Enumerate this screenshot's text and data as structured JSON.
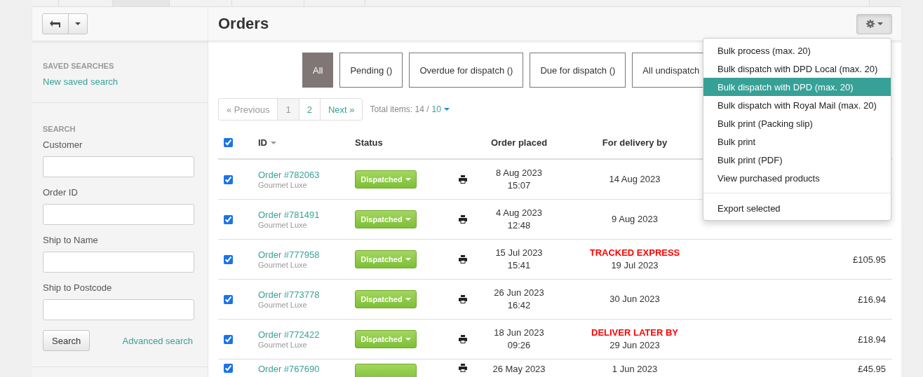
{
  "nav_tabs": [
    {
      "selected": false
    },
    {
      "selected": false
    },
    {
      "selected": true
    },
    {
      "selected": false
    },
    {
      "selected": false
    },
    {
      "selected": false
    },
    {
      "selected": false
    }
  ],
  "header": {
    "title": "Orders"
  },
  "sidebar": {
    "saved_searches": {
      "heading": "SAVED SEARCHES",
      "link": "New saved search"
    },
    "search": {
      "heading": "SEARCH",
      "fields": [
        {
          "label": "Customer"
        },
        {
          "label": "Order ID"
        },
        {
          "label": "Ship to Name"
        },
        {
          "label": "Ship to Postcode"
        }
      ],
      "button": "Search",
      "advanced_link": "Advanced search"
    }
  },
  "filters": [
    {
      "label": "All",
      "selected": true
    },
    {
      "label": "Pending ()",
      "selected": false
    },
    {
      "label": "Overdue for dispatch ()",
      "selected": false
    },
    {
      "label": "Due for dispatch ()",
      "selected": false
    },
    {
      "label": "All undispatch",
      "selected": false
    }
  ],
  "pagination": {
    "previous": {
      "label": "« Previous",
      "disabled": true
    },
    "pages": [
      {
        "label": "1",
        "selected": true
      },
      {
        "label": "2",
        "selected": false
      }
    ],
    "next": {
      "label": "Next »",
      "disabled": false
    },
    "total_label": "Total items:",
    "total": "14",
    "separator": "/",
    "per_page": "10"
  },
  "table": {
    "select_all_checked": true,
    "columns": [
      "ID",
      "Status",
      "Order placed",
      "For delivery by"
    ],
    "rows": [
      {
        "checked": true,
        "id": "Order #782063",
        "customer": "Gourmet Luxe",
        "status": "Dispatched",
        "placed_date": "8 Aug 2023",
        "placed_time": "15:07",
        "delivery": "14 Aug 2023"
      },
      {
        "checked": true,
        "id": "Order #781491",
        "customer": "Gourmet Luxe",
        "status": "Dispatched",
        "placed_date": "4 Aug 2023",
        "placed_time": "12:48",
        "delivery": "9 Aug 2023"
      },
      {
        "checked": true,
        "id": "Order #777958",
        "customer": "Gourmet Luxe",
        "status": "Dispatched",
        "placed_date": "15 Jul 2023",
        "placed_time": "15:41",
        "service": "TRACKED EXPRESS",
        "delivery": "19 Jul 2023",
        "total": "£105.95"
      },
      {
        "checked": true,
        "id": "Order #773778",
        "customer": "Gourmet Luxe",
        "status": "Dispatched",
        "placed_date": "26 Jun 2023",
        "placed_time": "16:42",
        "delivery": "30 Jun 2023",
        "total": "£16.94"
      },
      {
        "checked": true,
        "id": "Order #772422",
        "customer": "Gourmet Luxe",
        "status": "Dispatched",
        "placed_date": "18 Jun 2023",
        "placed_time": "09:26",
        "service": "DELIVER LATER BY",
        "delivery": "29 Jun 2023",
        "total": "£18.94"
      },
      {
        "checked": true,
        "id": "Order #767690",
        "placed_date": "26 May 2023",
        "delivery": "1 Jun 2023",
        "total": "£45.95"
      }
    ]
  },
  "actions_menu": {
    "items": [
      {
        "label": "Bulk process (max. 20)",
        "selected": false
      },
      {
        "label": "Bulk dispatch with DPD Local (max. 20)",
        "selected": false
      },
      {
        "label": "Bulk dispatch with DPD (max. 20)",
        "selected": true
      },
      {
        "label": "Bulk dispatch with Royal Mail (max. 20)",
        "selected": false
      },
      {
        "label": "Bulk print (Packing slip)",
        "selected": false
      },
      {
        "label": "Bulk print",
        "selected": false
      },
      {
        "label": "Bulk print (PDF)",
        "selected": false
      },
      {
        "label": "View purchased products",
        "selected": false
      }
    ],
    "footer_items": [
      {
        "label": "Export selected",
        "selected": false
      }
    ]
  }
}
